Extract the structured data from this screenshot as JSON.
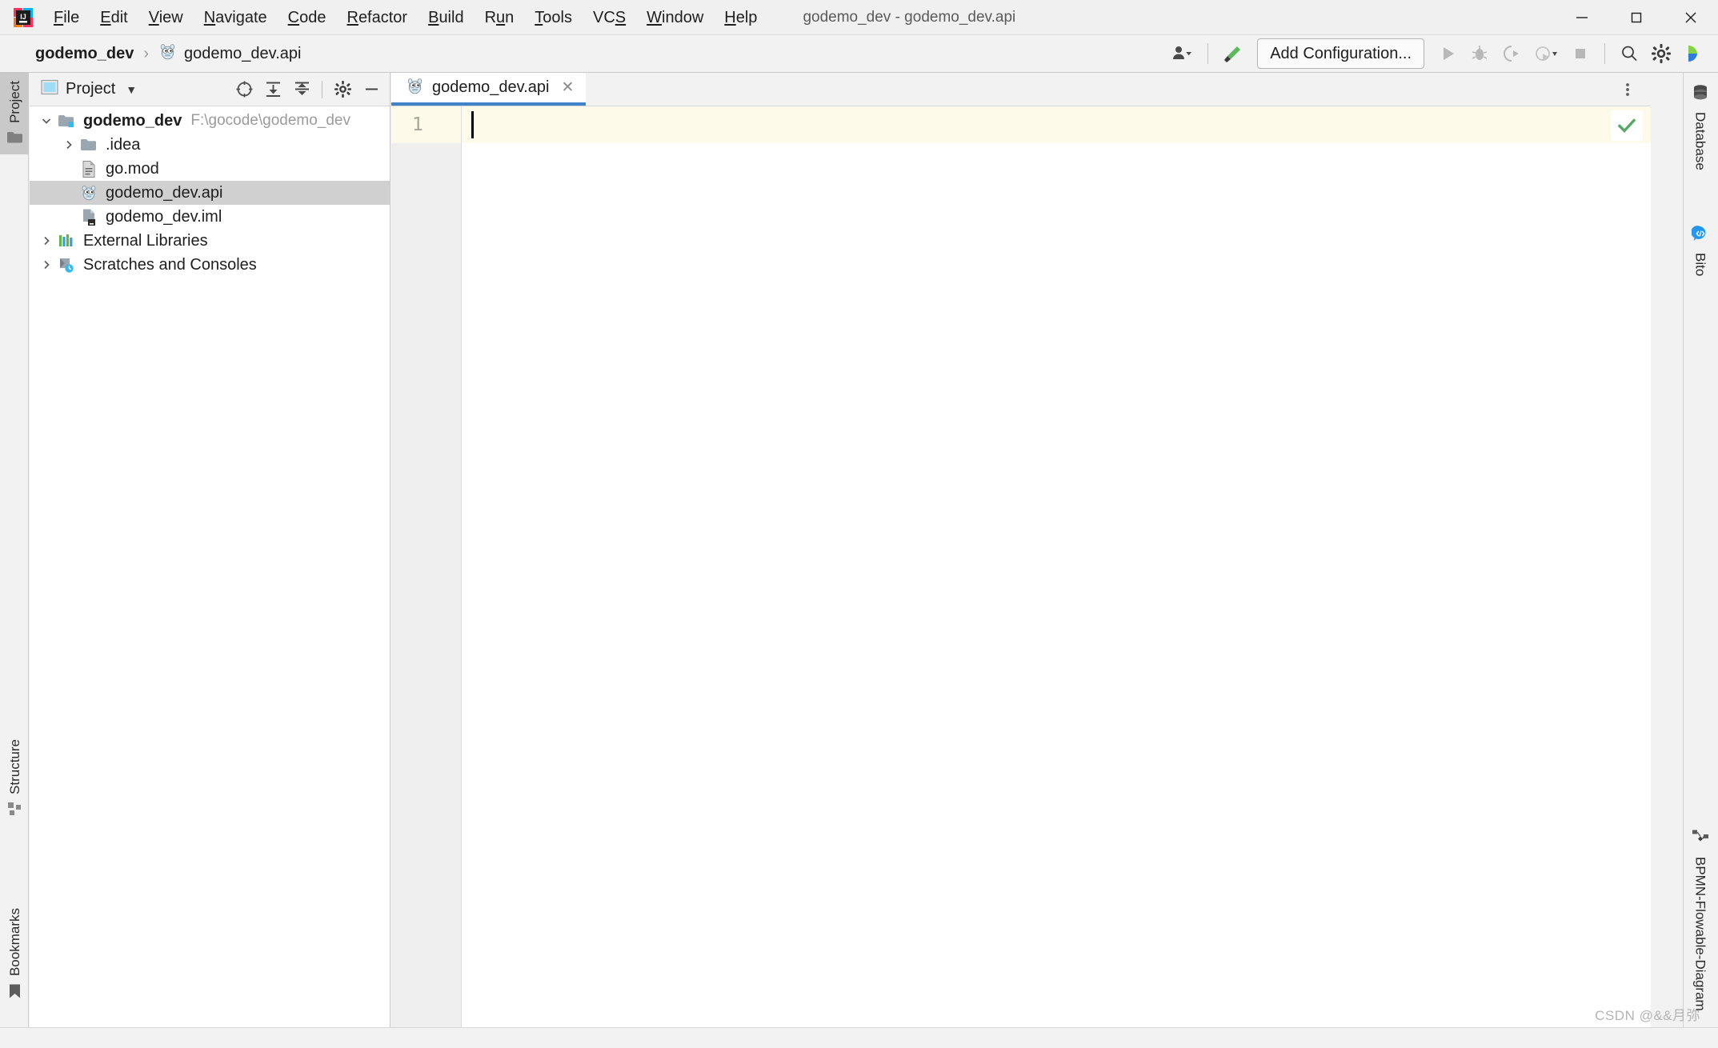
{
  "window": {
    "title": "godemo_dev - godemo_dev.api",
    "app_icon": "intellij-idea-icon",
    "controls": [
      {
        "name": "minimize",
        "glyph": "—"
      },
      {
        "name": "maximize",
        "glyph": "□"
      },
      {
        "name": "close",
        "glyph": "✕"
      }
    ]
  },
  "menubar": {
    "items": [
      {
        "label": "File",
        "mnemonic": "F"
      },
      {
        "label": "Edit",
        "mnemonic": "E"
      },
      {
        "label": "View",
        "mnemonic": "V"
      },
      {
        "label": "Navigate",
        "mnemonic": "N"
      },
      {
        "label": "Code",
        "mnemonic": "C"
      },
      {
        "label": "Refactor",
        "mnemonic": "R"
      },
      {
        "label": "Build",
        "mnemonic": "B"
      },
      {
        "label": "Run",
        "mnemonic": "u"
      },
      {
        "label": "Tools",
        "mnemonic": "T"
      },
      {
        "label": "VCS",
        "mnemonic": "S"
      },
      {
        "label": "Window",
        "mnemonic": "W"
      },
      {
        "label": "Help",
        "mnemonic": "H"
      }
    ]
  },
  "navbar": {
    "breadcrumb": {
      "project": "godemo_dev",
      "separator": "›",
      "file": "godemo_dev.api",
      "file_icon": "go-gopher-icon"
    },
    "run_config_label": "Add Configuration...",
    "buttons": [
      {
        "name": "user-account-icon",
        "tooltip": "Account"
      },
      {
        "name": "build-hammer-icon",
        "tooltip": "Build"
      },
      {
        "name": "run-icon",
        "tooltip": "Run"
      },
      {
        "name": "debug-icon",
        "tooltip": "Debug"
      },
      {
        "name": "run-coverage-icon",
        "tooltip": "Run with Coverage"
      },
      {
        "name": "profile-icon",
        "tooltip": "Profile"
      },
      {
        "name": "stop-icon",
        "tooltip": "Stop"
      },
      {
        "name": "search-everywhere-icon",
        "tooltip": "Search Everywhere"
      },
      {
        "name": "settings-gear-icon",
        "tooltip": "Settings"
      },
      {
        "name": "bito-icon",
        "tooltip": "Bito"
      }
    ]
  },
  "left_strip": {
    "tabs": [
      {
        "label": "Project",
        "icon": "folder-icon",
        "active": true
      },
      {
        "label": "Structure",
        "icon": "structure-icon",
        "active": false
      },
      {
        "label": "Bookmarks",
        "icon": "bookmark-icon",
        "active": false
      }
    ]
  },
  "project_panel": {
    "title": "Project",
    "view_icon": "project-view-icon",
    "dropdown_glyph": "▼",
    "toolbar": [
      {
        "name": "select-opened-file-icon",
        "tooltip": "Select Opened File"
      },
      {
        "name": "expand-all-icon",
        "tooltip": "Expand All"
      },
      {
        "name": "collapse-all-icon",
        "tooltip": "Collapse All"
      },
      {
        "name": "panel-settings-icon",
        "tooltip": "Settings"
      },
      {
        "name": "hide-panel-icon",
        "tooltip": "Hide"
      }
    ],
    "tree": [
      {
        "label": "godemo_dev",
        "sublabel": "F:\\gocode\\godemo_dev",
        "icon": "project-module-icon",
        "twisty": "⌄",
        "expanded": true,
        "indent": 0,
        "bold": true,
        "selected": false
      },
      {
        "label": ".idea",
        "sublabel": "",
        "icon": "folder-icon",
        "twisty": "›",
        "expanded": false,
        "indent": 1,
        "bold": false,
        "selected": false
      },
      {
        "label": "go.mod",
        "sublabel": "",
        "icon": "gomod-file-icon",
        "twisty": "",
        "expanded": false,
        "indent": 1,
        "bold": false,
        "selected": false
      },
      {
        "label": "godemo_dev.api",
        "sublabel": "",
        "icon": "go-gopher-icon",
        "twisty": "",
        "expanded": false,
        "indent": 1,
        "bold": false,
        "selected": true
      },
      {
        "label": "godemo_dev.iml",
        "sublabel": "",
        "icon": "iml-file-icon",
        "twisty": "",
        "expanded": false,
        "indent": 1,
        "bold": false,
        "selected": false
      },
      {
        "label": "External Libraries",
        "sublabel": "",
        "icon": "libraries-icon",
        "twisty": "›",
        "expanded": false,
        "indent": 0,
        "bold": false,
        "selected": false
      },
      {
        "label": "Scratches and Consoles",
        "sublabel": "",
        "icon": "scratches-icon",
        "twisty": "›",
        "expanded": false,
        "indent": 0,
        "bold": false,
        "selected": false
      }
    ]
  },
  "editor": {
    "tabs": [
      {
        "label": "godemo_dev.api",
        "icon": "go-gopher-icon",
        "active": true,
        "close_glyph": "✕"
      }
    ],
    "tab_options_glyph": "⋮",
    "line_numbers": [
      "1"
    ],
    "content_lines": [
      ""
    ],
    "caret_line": 1,
    "caret_column": 1,
    "inspection_status": "ok-checkmark-icon"
  },
  "right_strip": {
    "tabs": [
      {
        "label": "Database",
        "icon": "database-icon"
      },
      {
        "label": "Bito",
        "icon": "bito-chat-icon"
      },
      {
        "label": "BPMN-Flowable-Diagram",
        "icon": "bpmn-diagram-icon"
      }
    ]
  },
  "statusbar": {
    "watermark": "CSDN @&&月弥"
  },
  "colors": {
    "accent_tab_underline": "#4083c9",
    "current_line": "#fdfae9",
    "selection": "#d0d0d0",
    "panel_bg": "#f2f2f2",
    "editor_bg": "#ffffff",
    "gutter_bg": "#efefef",
    "text": "#1e1e1e",
    "muted_text": "#9b9b9b",
    "ok_green": "#59a869"
  }
}
